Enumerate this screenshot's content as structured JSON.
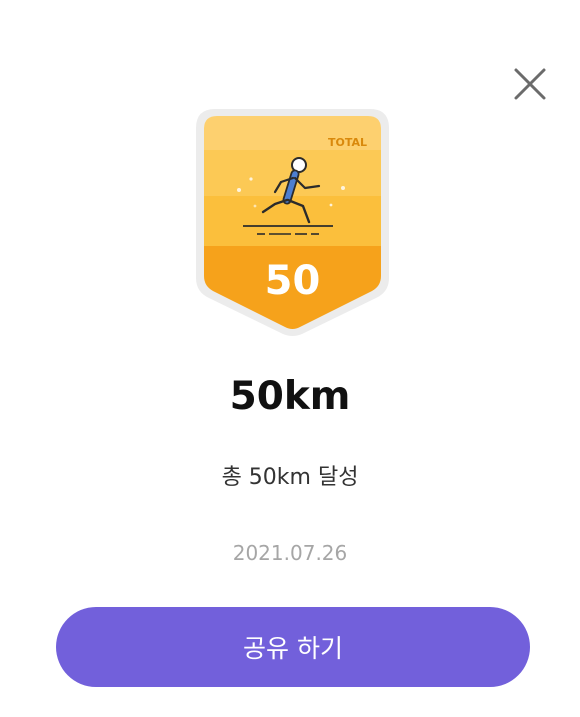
{
  "badge": {
    "label": "TOTAL",
    "number": "50",
    "icon": "running-person-icon",
    "colors": {
      "light": "#fdd06f",
      "mid": "#fbbf3c",
      "dark": "#f6a21b",
      "rim": "#ececec"
    }
  },
  "achievement": {
    "title": "50km",
    "description": "총 50km 달성",
    "date": "2021.07.26"
  },
  "actions": {
    "close_icon": "close-icon",
    "share_label": "공유 하기"
  },
  "colors": {
    "accent": "#7260db",
    "title": "#111111",
    "date": "#a6a6a6"
  }
}
